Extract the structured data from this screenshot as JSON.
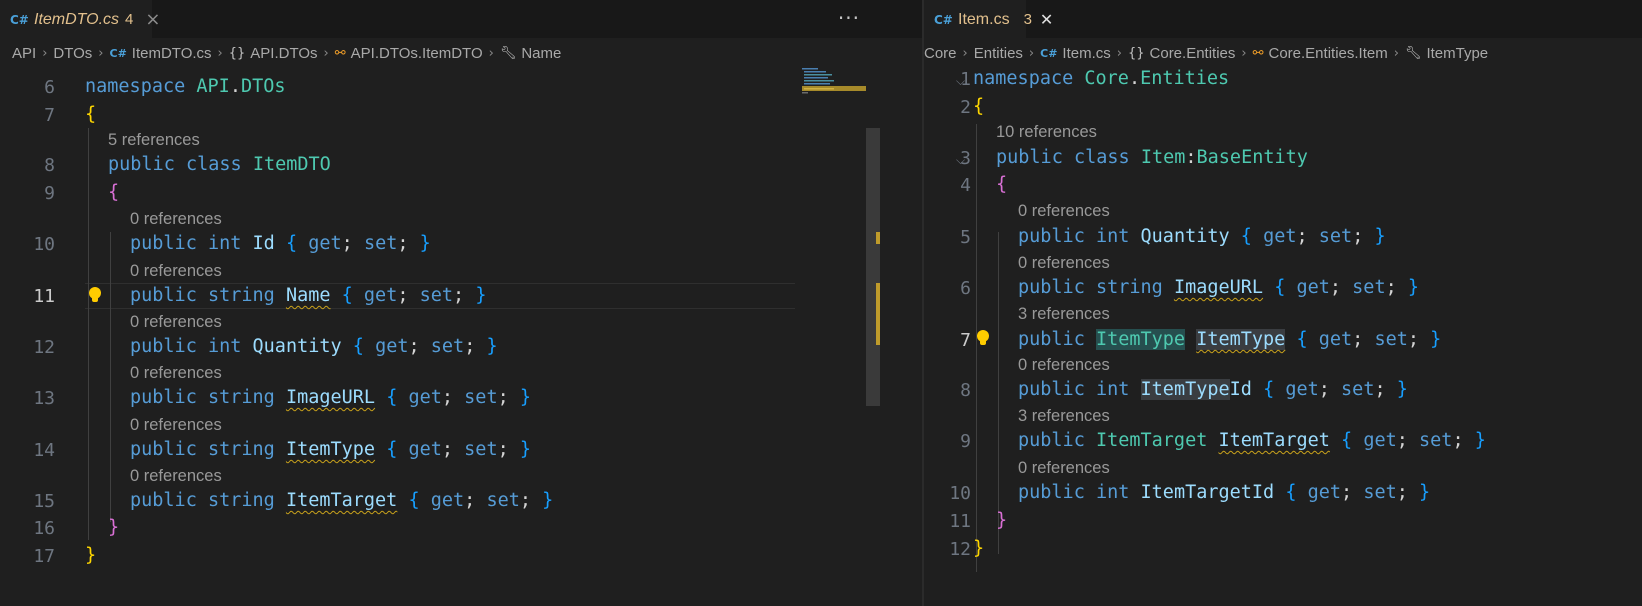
{
  "left": {
    "tab": {
      "name": "ItemDTO.cs",
      "count": "4",
      "close": "×"
    },
    "more": "···",
    "breadcrumb": [
      "API",
      "DTOs",
      "ItemDTO.cs",
      "API.DTOs",
      "API.DTOs.ItemDTO",
      "Name"
    ],
    "lines": {
      "l6": {
        "n": "6",
        "kw": "namespace",
        "ns1": "API",
        "dot": ".",
        "ns2": "DTOs"
      },
      "l7": {
        "n": "7",
        "brace": "{"
      },
      "lens8": "5 references",
      "l8": {
        "n": "8",
        "kw1": "public",
        "kw2": "class",
        "type": "ItemDTO"
      },
      "l9": {
        "n": "9",
        "brace": "{"
      },
      "lens10": "0 references",
      "l10": {
        "n": "10",
        "kw1": "public",
        "kw2": "int",
        "prop": "Id"
      },
      "lens11": "0 references",
      "l11": {
        "n": "11",
        "kw1": "public",
        "kw2": "string",
        "prop": "Name"
      },
      "lens12": "0 references",
      "l12": {
        "n": "12",
        "kw1": "public",
        "kw2": "int",
        "prop": "Quantity"
      },
      "lens13": "0 references",
      "l13": {
        "n": "13",
        "kw1": "public",
        "kw2": "string",
        "prop": "ImageURL"
      },
      "lens14": "0 references",
      "l14": {
        "n": "14",
        "kw1": "public",
        "kw2": "string",
        "prop": "ItemType"
      },
      "lens15": "0 references",
      "l15": {
        "n": "15",
        "kw1": "public",
        "kw2": "string",
        "prop": "ItemTarget"
      },
      "l16": {
        "n": "16",
        "brace": "}"
      },
      "l17": {
        "n": "17",
        "brace": "}"
      }
    }
  },
  "right": {
    "tab": {
      "name": "Item.cs",
      "count": "3",
      "close": "✕"
    },
    "breadcrumb": [
      "Core",
      "Entities",
      "Item.cs",
      "Core.Entities",
      "Core.Entities.Item",
      "ItemType"
    ],
    "lines": {
      "l1": {
        "n": "1",
        "kw": "namespace",
        "ns1": "Core",
        "dot": ".",
        "ns2": "Entities"
      },
      "l2": {
        "n": "2",
        "brace": "{"
      },
      "lens3": "10 references",
      "l3": {
        "n": "3",
        "kw1": "public",
        "kw2": "class",
        "type": "Item",
        "colon": ":",
        "base": "BaseEntity"
      },
      "l4": {
        "n": "4",
        "brace": "{"
      },
      "lens5": "0 references",
      "l5": {
        "n": "5",
        "kw1": "public",
        "kw2": "int",
        "prop": "Quantity"
      },
      "lens6": "0 references",
      "l6": {
        "n": "6",
        "kw1": "public",
        "kw2": "string",
        "prop": "ImageURL"
      },
      "lens7": "3 references",
      "l7": {
        "n": "7",
        "kw1": "public",
        "type": "ItemType",
        "prop": "ItemType"
      },
      "lens8": "0 references",
      "l8": {
        "n": "8",
        "kw1": "public",
        "kw2": "int",
        "prop_a": "ItemType",
        "prop_b": "Id"
      },
      "lens9": "3 references",
      "l9": {
        "n": "9",
        "kw1": "public",
        "type": "ItemTarget",
        "prop": "ItemTarget"
      },
      "lens10": "0 references",
      "l10": {
        "n": "10",
        "kw1": "public",
        "kw2": "int",
        "prop": "ItemTargetId"
      },
      "l11": {
        "n": "11",
        "brace": "}"
      },
      "l12": {
        "n": "12",
        "brace": "}"
      }
    }
  },
  "accessor": {
    "open": "{",
    "get": "get",
    "semi": ";",
    "set": "set",
    "close": "}"
  },
  "colors": {
    "keyword": "#569cd6",
    "type": "#4ec9b0",
    "property": "#9cdcfe",
    "bracket1": "#ffd700",
    "bracket2": "#da70d6",
    "bracket3": "#179fff",
    "tab_modified": "#e2c08d"
  }
}
